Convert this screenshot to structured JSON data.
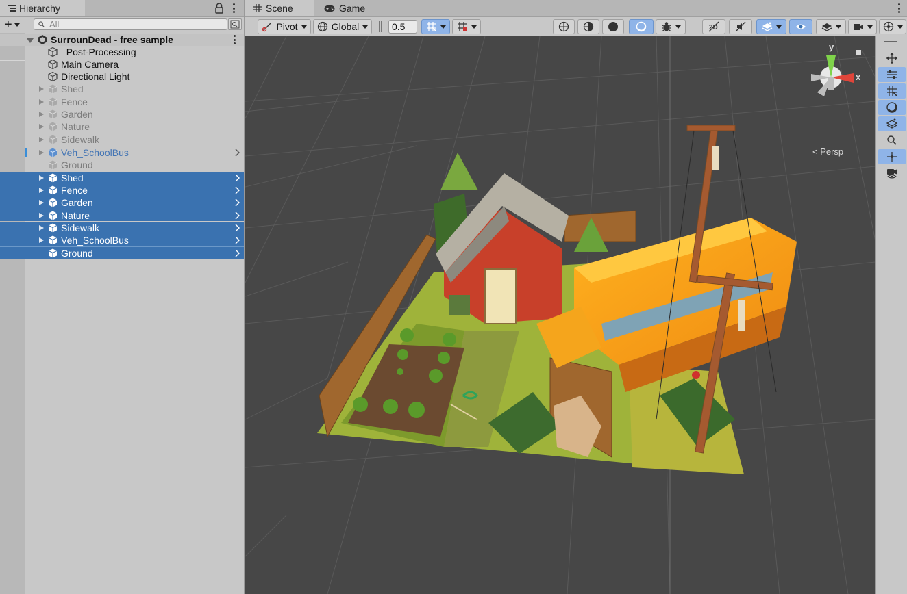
{
  "hierarchy": {
    "tab_title": "Hierarchy",
    "search_placeholder": "All",
    "scene_name": "SurrounDead - free sample",
    "rows": [
      {
        "label": "_Post-Processing",
        "style": "normal"
      },
      {
        "label": "Main Camera",
        "style": "normal"
      },
      {
        "label": "Directional Light",
        "style": "normal"
      },
      {
        "label": "Shed",
        "style": "dim"
      },
      {
        "label": "Fence",
        "style": "dim"
      },
      {
        "label": "Garden",
        "style": "dim"
      },
      {
        "label": "Nature",
        "style": "dim"
      },
      {
        "label": "Sidewalk",
        "style": "dim"
      },
      {
        "label": "Veh_SchoolBus",
        "style": "prefab"
      },
      {
        "label": "Ground",
        "style": "dim"
      },
      {
        "label": "Shed",
        "style": "selected"
      },
      {
        "label": "Fence",
        "style": "selected"
      },
      {
        "label": "Garden",
        "style": "selected"
      },
      {
        "label": "Nature",
        "style": "selected"
      },
      {
        "label": "Sidewalk",
        "style": "selected"
      },
      {
        "label": "Veh_SchoolBus",
        "style": "selected"
      },
      {
        "label": "Ground",
        "style": "selected"
      }
    ]
  },
  "scene_view": {
    "tabs": [
      {
        "label": "Scene",
        "icon": "grid-icon"
      },
      {
        "label": "Game",
        "icon": "gamepad-icon"
      }
    ],
    "toolbar": {
      "pivot_label": "Pivot",
      "global_label": "Global",
      "snap_value": "0.5"
    },
    "gizmo": {
      "y_label": "y",
      "x_label": "x",
      "projection_label": "< Persp"
    }
  },
  "colors": {
    "selection": "#3a72b0",
    "toggle_on": "#8fb4e8",
    "viewport_bg": "#474747",
    "panel_bg": "#c8c8c8"
  }
}
